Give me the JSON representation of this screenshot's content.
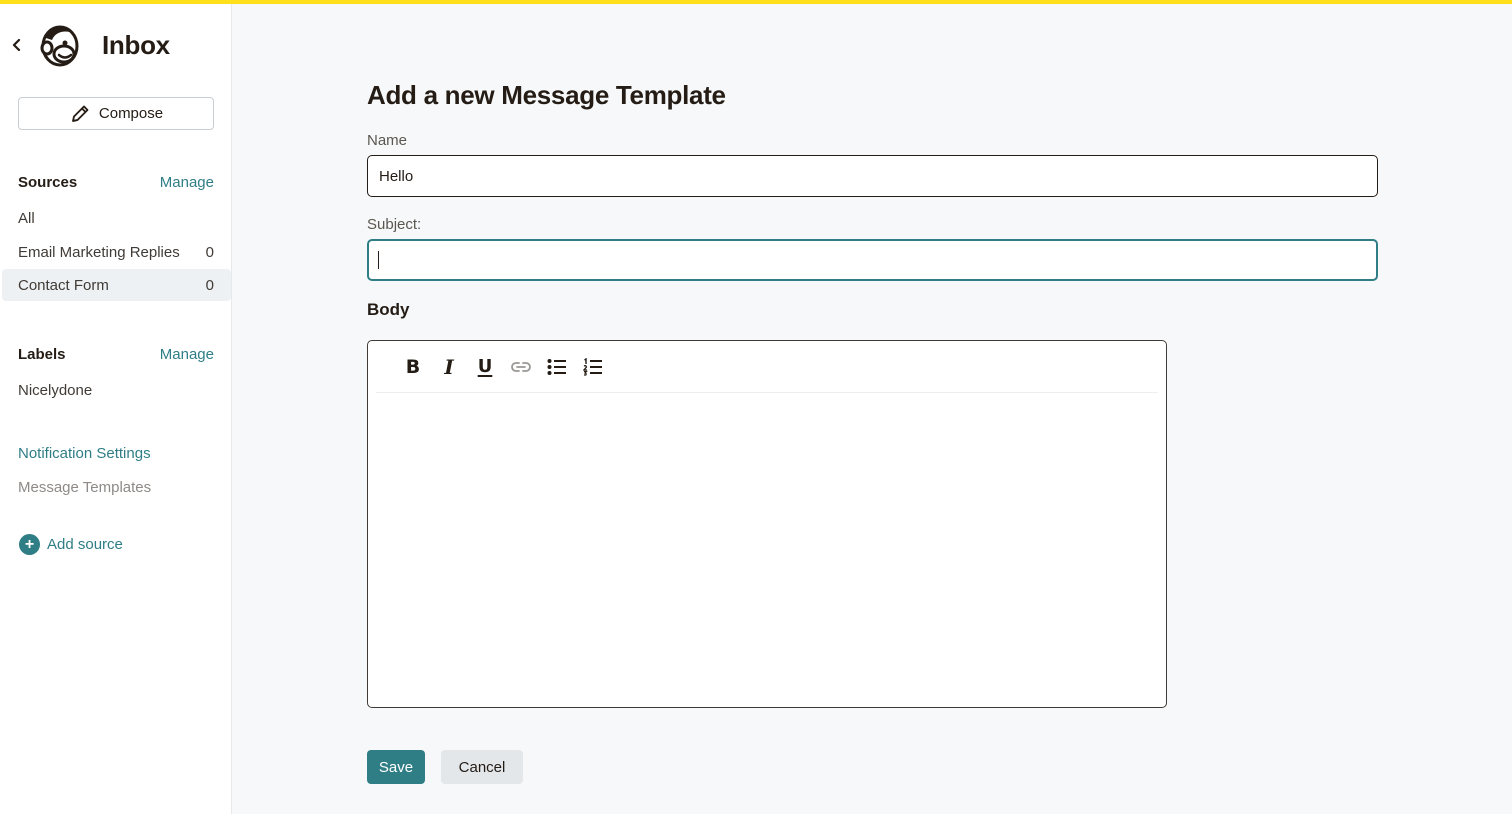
{
  "app": {
    "title": "Inbox",
    "accent_color": "#ffe01b",
    "brand_color": "#2f7e86",
    "logo_icon": "freddie-monkey-logo"
  },
  "sidebar": {
    "compose_label": "Compose",
    "sources": {
      "heading": "Sources",
      "manage_label": "Manage",
      "items": [
        {
          "label": "All",
          "count": ""
        },
        {
          "label": "Email Marketing Replies",
          "count": "0"
        },
        {
          "label": "Contact Form",
          "count": "0",
          "active": true
        }
      ]
    },
    "labels": {
      "heading": "Labels",
      "manage_label": "Manage",
      "items": [
        {
          "label": "Nicelydone"
        }
      ]
    },
    "notification_settings": "Notification Settings",
    "message_templates": "Message Templates",
    "add_source": "Add source"
  },
  "form": {
    "title": "Add a new Message Template",
    "name_label": "Name",
    "name_value": "Hello",
    "subject_label": "Subject:",
    "subject_value": "",
    "body_label": "Body",
    "toolbar": [
      "bold",
      "italic",
      "underline",
      "link",
      "bulleted-list",
      "numbered-list"
    ],
    "save_label": "Save",
    "cancel_label": "Cancel"
  }
}
